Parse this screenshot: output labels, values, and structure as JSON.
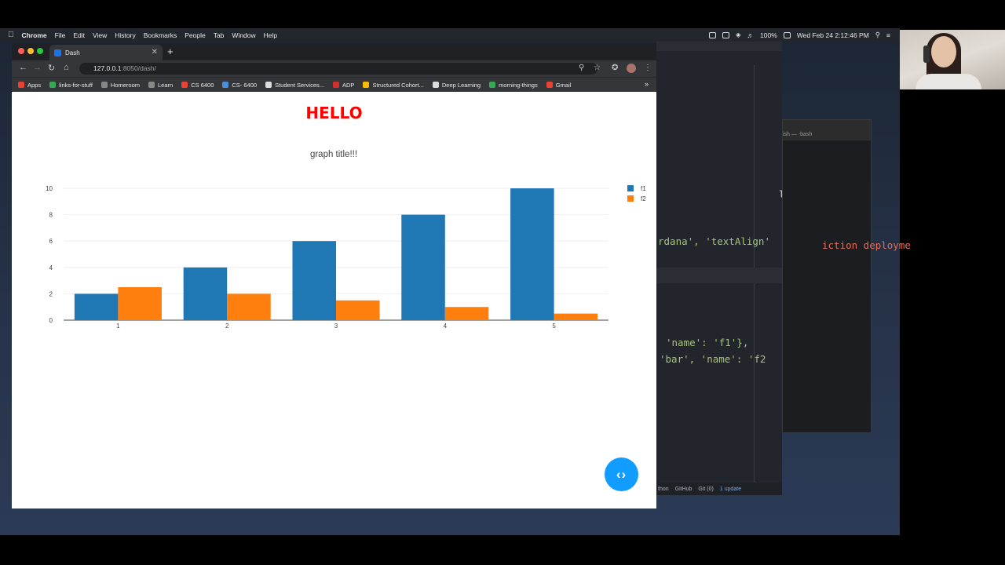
{
  "menubar": {
    "app_name": "Chrome",
    "items": [
      "File",
      "Edit",
      "View",
      "History",
      "Bookmarks",
      "People",
      "Tab",
      "Window",
      "Help"
    ],
    "battery": "100%",
    "datetime": "Wed Feb 24  2:12:46 PM"
  },
  "browser": {
    "tab_title": "Dash",
    "url_host": "127.0.0.1",
    "url_path": ":8050/dash/",
    "bookmarks": [
      {
        "label": "Apps",
        "color": "#e94235"
      },
      {
        "label": "links-for-stuff",
        "color": "#34a853"
      },
      {
        "label": "Homeroom",
        "color": "#888888"
      },
      {
        "label": "Learn",
        "color": "#888888"
      },
      {
        "label": "CS 6400",
        "color": "#ea4335"
      },
      {
        "label": "CS- 6400",
        "color": "#4a90d9"
      },
      {
        "label": "Student Services...",
        "color": "#dddddd"
      },
      {
        "label": "ADP",
        "color": "#d32f2f"
      },
      {
        "label": "Structured Cohort...",
        "color": "#fbbc04"
      },
      {
        "label": "Deep Learning",
        "color": "#dddddd"
      },
      {
        "label": "morning-things",
        "color": "#34a853"
      },
      {
        "label": "Gmail",
        "color": "#ea4335"
      }
    ]
  },
  "page": {
    "heading": "HELLO"
  },
  "chart_data": {
    "type": "bar",
    "title": "graph title!!!",
    "x": [
      1,
      2,
      3,
      4,
      5
    ],
    "series": [
      {
        "name": "f1",
        "values": [
          2,
          4,
          6,
          8,
          10
        ],
        "color": "#1f77b4"
      },
      {
        "name": "f2",
        "values": [
          2.5,
          2,
          1.5,
          1,
          0.5
        ],
        "color": "#ff7f0e"
      }
    ],
    "ylim": [
      0,
      10
    ],
    "yticks": [
      0,
      2,
      4,
      6,
      8,
      10
    ],
    "grid": true,
    "legend": "top-right"
  },
  "editor": {
    "lines": [
      "l.",
      "rdana', 'textAlign'",
      "'name': 'f1'},",
      "'bar', 'name': 'f2"
    ],
    "red_line": "iction deployme",
    "status": {
      "lang": "thon",
      "github": "GitHub",
      "git": "Git (0)",
      "update": "1 update"
    }
  },
  "terminal": {
    "title": "ish — -bash"
  },
  "colors": {
    "heading": "#ff0000",
    "code_toggle": "#119dff"
  }
}
